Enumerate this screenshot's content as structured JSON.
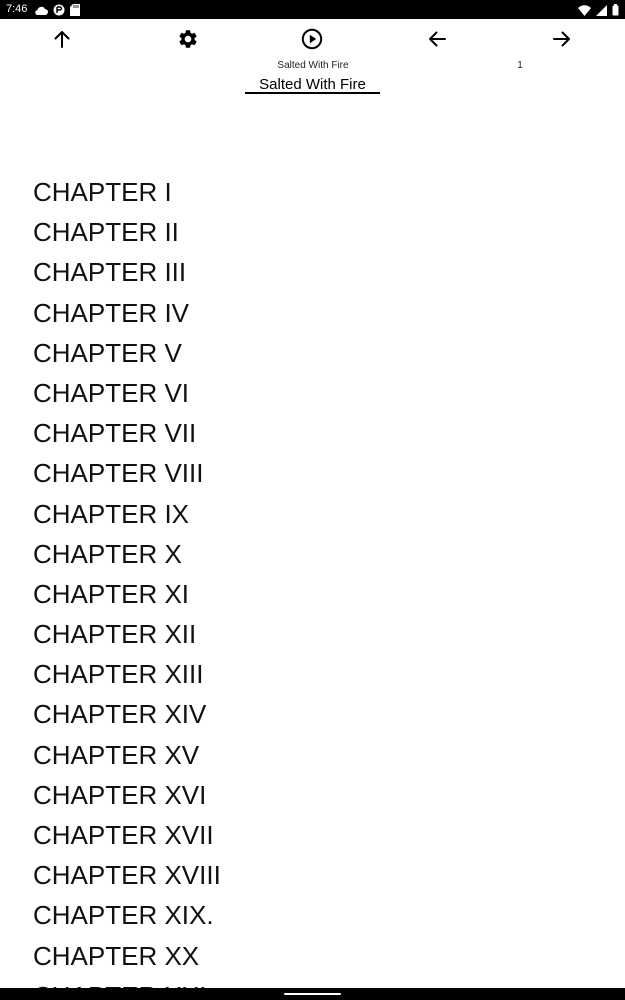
{
  "status_bar": {
    "time": "7:46",
    "left_icons": [
      "cloud-icon",
      "app-icon",
      "sd-card-icon"
    ],
    "right_icons": [
      "wifi-icon",
      "signal-icon",
      "battery-icon"
    ]
  },
  "toolbar": {
    "buttons": [
      "up-arrow-icon",
      "gear-icon",
      "play-circle-icon",
      "back-arrow-icon",
      "forward-arrow-icon"
    ]
  },
  "meta": {
    "title": "Salted With Fire",
    "page": "1"
  },
  "book": {
    "title": "Salted With Fire"
  },
  "toc": {
    "chapters": [
      "CHAPTER I",
      "CHAPTER II",
      "CHAPTER III",
      "CHAPTER IV",
      "CHAPTER V",
      "CHAPTER VI",
      "CHAPTER VII",
      "CHAPTER VIII",
      "CHAPTER IX",
      "CHAPTER X",
      "CHAPTER XI",
      "CHAPTER XII",
      "CHAPTER XIII",
      "CHAPTER XIV",
      "CHAPTER XV",
      "CHAPTER XVI",
      "CHAPTER XVII",
      "CHAPTER XVIII",
      "CHAPTER XIX.",
      "CHAPTER XX",
      "CHAPTER XXI"
    ]
  }
}
